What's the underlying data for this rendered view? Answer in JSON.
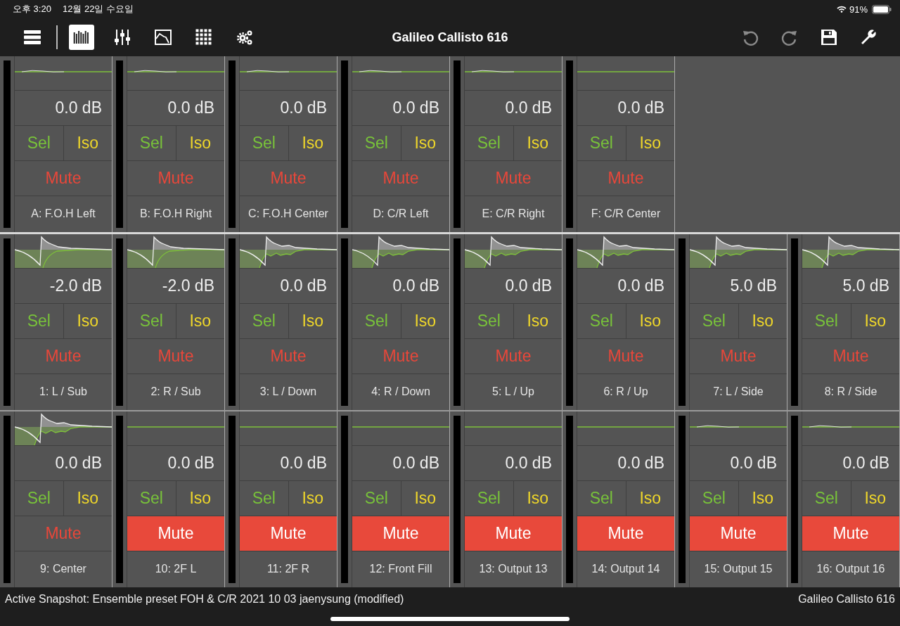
{
  "status_bar": {
    "time": "오후 3:20",
    "date": "12월 22일 수요일",
    "battery": "91%"
  },
  "toolbar": {
    "tabs": [
      {
        "kind": "rack",
        "selected": false
      },
      {
        "kind": "meters",
        "selected": true
      },
      {
        "kind": "faders",
        "selected": false
      },
      {
        "kind": "curve",
        "selected": false
      },
      {
        "kind": "grid",
        "selected": false
      },
      {
        "kind": "gears",
        "selected": false
      }
    ],
    "title": "Galileo Callisto 616",
    "actions": [
      {
        "kind": "undo"
      },
      {
        "kind": "redo"
      },
      {
        "kind": "save"
      },
      {
        "kind": "wrench"
      }
    ]
  },
  "strip_rows": [
    {
      "strips": [
        {
          "kind": "ripple",
          "gain": "0.0 dB",
          "sel": "Sel",
          "iso": "Iso",
          "mute": "Mute",
          "muted": false,
          "name": "A: F.O.H Left"
        },
        {
          "kind": "ripple",
          "gain": "0.0 dB",
          "sel": "Sel",
          "iso": "Iso",
          "mute": "Mute",
          "muted": false,
          "name": "B: F.O.H Right"
        },
        {
          "kind": "ripple",
          "gain": "0.0 dB",
          "sel": "Sel",
          "iso": "Iso",
          "mute": "Mute",
          "muted": false,
          "name": "C: F.O.H Center"
        },
        {
          "kind": "ripple",
          "gain": "0.0 dB",
          "sel": "Sel",
          "iso": "Iso",
          "mute": "Mute",
          "muted": false,
          "name": "D: C/R Left"
        },
        {
          "kind": "ripple",
          "gain": "0.0 dB",
          "sel": "Sel",
          "iso": "Iso",
          "mute": "Mute",
          "muted": false,
          "name": "E: C/R Right"
        },
        {
          "kind": "flat",
          "gain": "0.0 dB",
          "sel": "Sel",
          "iso": "Iso",
          "mute": "Mute",
          "muted": false,
          "name": "F: C/R Center"
        }
      ]
    },
    {
      "strips": [
        {
          "kind": "impulse_deep",
          "gain": "-2.0 dB",
          "sel": "Sel",
          "iso": "Iso",
          "mute": "Mute",
          "muted": false,
          "name": "1: L / Sub"
        },
        {
          "kind": "impulse_deep",
          "gain": "-2.0 dB",
          "sel": "Sel",
          "iso": "Iso",
          "mute": "Mute",
          "muted": false,
          "name": "2: R / Sub"
        },
        {
          "kind": "impulse",
          "gain": "0.0 dB",
          "sel": "Sel",
          "iso": "Iso",
          "mute": "Mute",
          "muted": false,
          "name": "3: L / Down"
        },
        {
          "kind": "impulse",
          "gain": "0.0 dB",
          "sel": "Sel",
          "iso": "Iso",
          "mute": "Mute",
          "muted": false,
          "name": "4: R / Down"
        },
        {
          "kind": "impulse",
          "gain": "0.0 dB",
          "sel": "Sel",
          "iso": "Iso",
          "mute": "Mute",
          "muted": false,
          "name": "5: L / Up"
        },
        {
          "kind": "impulse",
          "gain": "0.0 dB",
          "sel": "Sel",
          "iso": "Iso",
          "mute": "Mute",
          "muted": false,
          "name": "6: R / Up"
        },
        {
          "kind": "impulse",
          "gain": "5.0 dB",
          "sel": "Sel",
          "iso": "Iso",
          "mute": "Mute",
          "muted": false,
          "name": "7: L / Side"
        },
        {
          "kind": "impulse",
          "gain": "5.0 dB",
          "sel": "Sel",
          "iso": "Iso",
          "mute": "Mute",
          "muted": false,
          "name": "8: R / Side"
        }
      ]
    },
    {
      "strips": [
        {
          "kind": "impulse",
          "gain": "0.0 dB",
          "sel": "Sel",
          "iso": "Iso",
          "mute": "Mute",
          "muted": false,
          "name": "9: Center"
        },
        {
          "kind": "flat",
          "gain": "0.0 dB",
          "sel": "Sel",
          "iso": "Iso",
          "mute": "Mute",
          "muted": true,
          "name": "10: 2F L"
        },
        {
          "kind": "flat",
          "gain": "0.0 dB",
          "sel": "Sel",
          "iso": "Iso",
          "mute": "Mute",
          "muted": true,
          "name": "11: 2F R"
        },
        {
          "kind": "flat",
          "gain": "0.0 dB",
          "sel": "Sel",
          "iso": "Iso",
          "mute": "Mute",
          "muted": true,
          "name": "12: Front Fill"
        },
        {
          "kind": "flat",
          "gain": "0.0 dB",
          "sel": "Sel",
          "iso": "Iso",
          "mute": "Mute",
          "muted": true,
          "name": "13: Output 13"
        },
        {
          "kind": "flat",
          "gain": "0.0 dB",
          "sel": "Sel",
          "iso": "Iso",
          "mute": "Mute",
          "muted": true,
          "name": "14: Output 14"
        },
        {
          "kind": "ripple",
          "gain": "0.0 dB",
          "sel": "Sel",
          "iso": "Iso",
          "mute": "Mute",
          "muted": true,
          "name": "15: Output 15"
        },
        {
          "kind": "ripple",
          "gain": "0.0 dB",
          "sel": "Sel",
          "iso": "Iso",
          "mute": "Mute",
          "muted": true,
          "name": "16: Output 16"
        }
      ]
    }
  ],
  "footer": {
    "snapshot": "Active Snapshot: Ensemble preset FOH & C/R 2021 10 03 jaenysung (modified)",
    "device": "Galileo Callisto 616"
  }
}
